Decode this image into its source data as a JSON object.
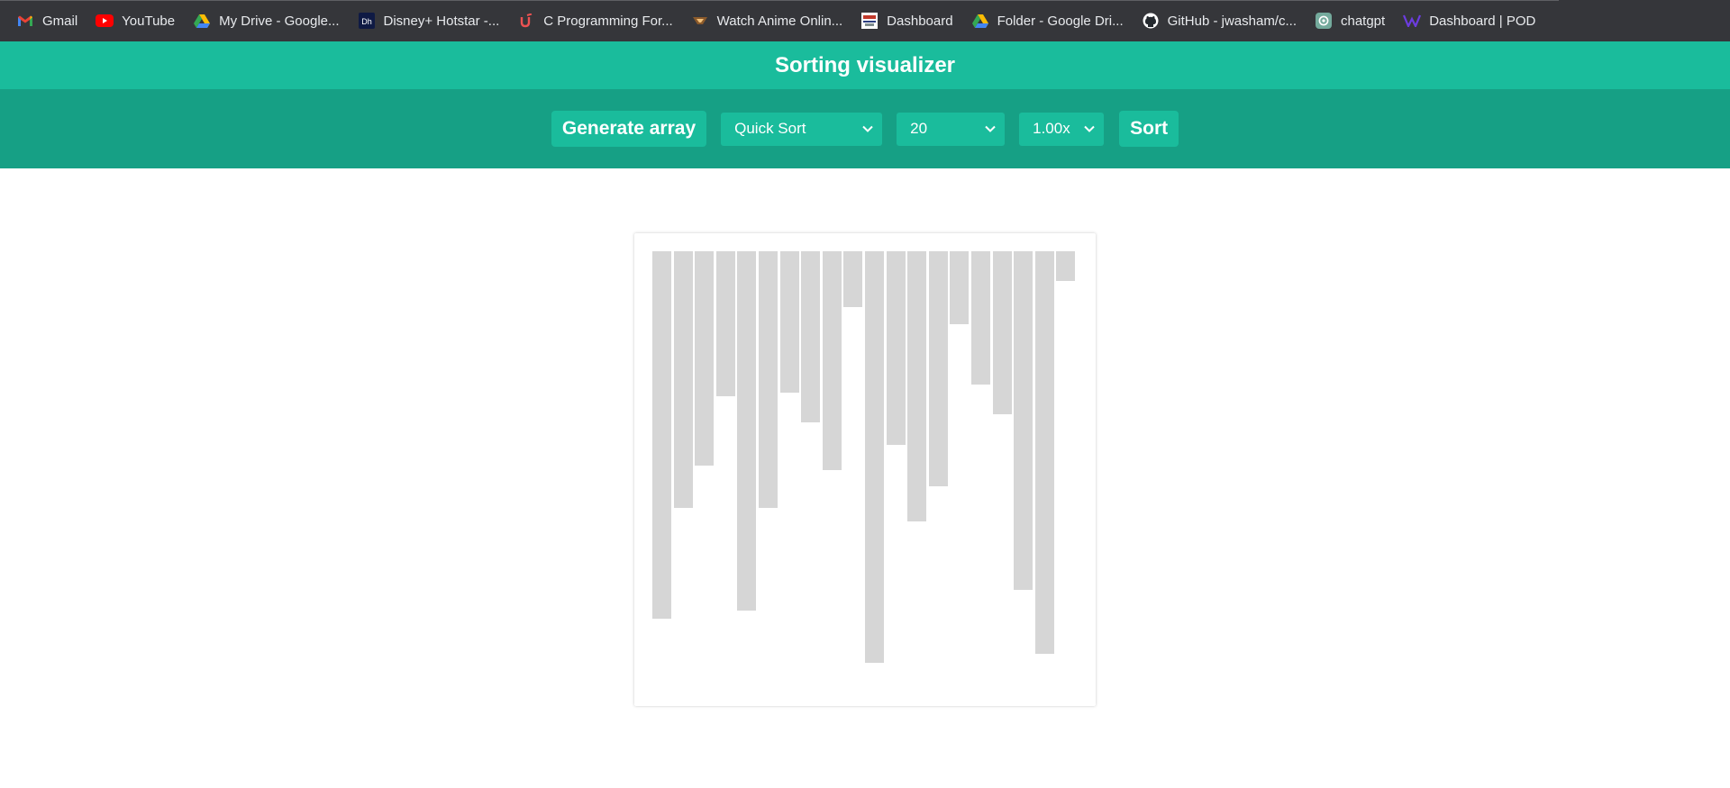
{
  "bookmarks": [
    {
      "label": "Gmail",
      "icon": "gmail-icon"
    },
    {
      "label": "YouTube",
      "icon": "youtube-icon"
    },
    {
      "label": "My Drive - Google...",
      "icon": "google-drive-icon"
    },
    {
      "label": "Disney+ Hotstar -...",
      "icon": "hotstar-icon"
    },
    {
      "label": "C Programming For...",
      "icon": "udemy-icon"
    },
    {
      "label": "Watch Anime Onlin...",
      "icon": "anime-site-icon"
    },
    {
      "label": "Dashboard",
      "icon": "dashboard-site-icon"
    },
    {
      "label": "Folder - Google Dri...",
      "icon": "google-drive-icon"
    },
    {
      "label": "GitHub - jwasham/c...",
      "icon": "github-icon"
    },
    {
      "label": "chatgpt",
      "icon": "chatgpt-icon"
    },
    {
      "label": "Dashboard | POD",
      "icon": "pod-icon"
    }
  ],
  "header": {
    "title": "Sorting visualizer"
  },
  "controls": {
    "generate_label": "Generate array",
    "algorithm": "Quick Sort",
    "array_size": "20",
    "speed": "1.00x",
    "sort_label": "Sort"
  },
  "colors": {
    "title_bar": "#1abc9c",
    "controls_bar": "#16a085",
    "bar": "#d6d6d6"
  },
  "chart_data": {
    "type": "bar",
    "values": [
      408,
      285,
      238,
      161,
      399,
      285,
      157,
      190,
      243,
      62,
      457,
      215,
      300,
      261,
      81,
      148,
      181,
      376,
      447,
      33
    ]
  }
}
